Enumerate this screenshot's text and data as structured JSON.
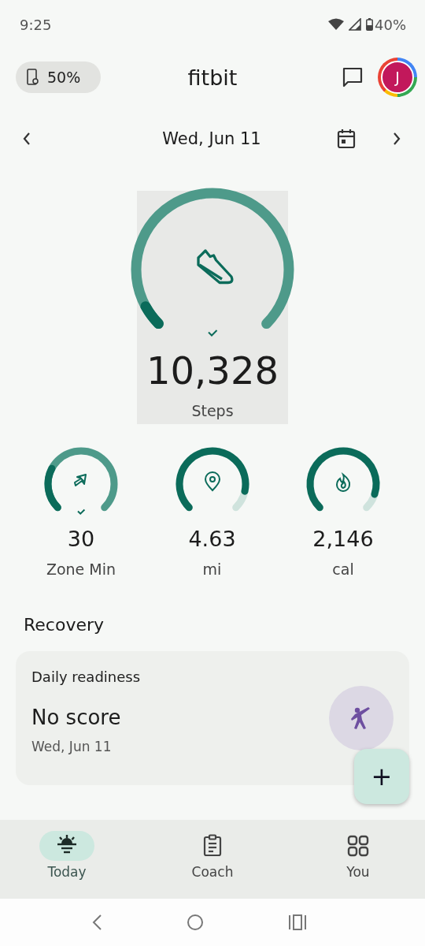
{
  "status_bar": {
    "time": "9:25",
    "battery": "40%"
  },
  "header": {
    "device_battery": "50%",
    "title": "fitbit",
    "avatar_initial": "J"
  },
  "date_nav": {
    "date": "Wed, Jun 11"
  },
  "steps": {
    "value": "10,328",
    "label": "Steps",
    "achieved": true
  },
  "stats": [
    {
      "kind": "zone",
      "value": "30",
      "label": "Zone Min",
      "achieved": true
    },
    {
      "kind": "distance",
      "value": "4.63",
      "label": "mi",
      "achieved": false
    },
    {
      "kind": "calories",
      "value": "2,146",
      "label": "cal",
      "achieved": false
    }
  ],
  "section_title": "Recovery",
  "readiness_card": {
    "title": "Daily readiness",
    "score": "No score",
    "date": "Wed, Jun 11"
  },
  "fab": {
    "label": "+"
  },
  "bottom_nav": [
    {
      "kind": "today",
      "label": "Today",
      "selected": true
    },
    {
      "kind": "coach",
      "label": "Coach",
      "selected": false
    },
    {
      "kind": "you",
      "label": "You",
      "selected": false
    }
  ]
}
